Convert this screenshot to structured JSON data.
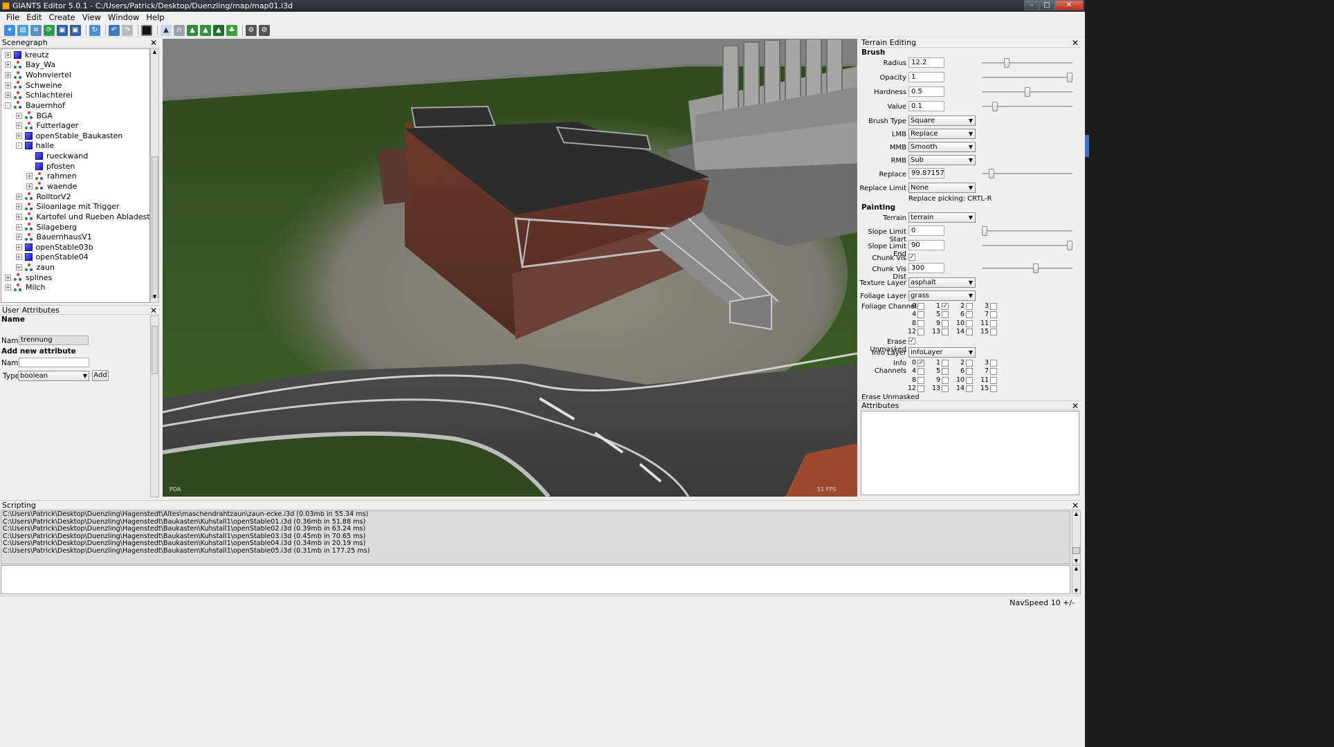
{
  "window": {
    "title": "GIANTS Editor 5.0.1 - C:/Users/Patrick/Desktop/Duenzling/map/map01.i3d"
  },
  "menu": [
    "File",
    "Edit",
    "Create",
    "View",
    "Window",
    "Help"
  ],
  "toolbar": {
    "icons": [
      "new-icon",
      "open-icon",
      "import-icon",
      "reload-icon",
      "save-icon",
      "save-all-icon",
      "refresh-icon",
      "undo-icon",
      "redo-icon",
      "stop-icon",
      "select-icon",
      "transform-icon",
      "terrain-sculpt-icon",
      "terrain-paint-icon",
      "foliage-paint-icon",
      "foliage-icon",
      "settings-icon",
      "render-settings-icon"
    ]
  },
  "scenegraph": {
    "title": "Scenegraph",
    "items": [
      {
        "label": "kreutz",
        "level": 0,
        "icon": "cube",
        "expander": "+"
      },
      {
        "label": "Bay_Wa",
        "level": 0,
        "icon": "transform",
        "expander": "+"
      },
      {
        "label": "Wohnviertel",
        "level": 0,
        "icon": "transform",
        "expander": "+"
      },
      {
        "label": "Schweine",
        "level": 0,
        "icon": "transform",
        "expander": "+"
      },
      {
        "label": "Schlachterei",
        "level": 0,
        "icon": "transform",
        "expander": "+"
      },
      {
        "label": "Bauernhof",
        "level": 0,
        "icon": "transform",
        "expander": "-"
      },
      {
        "label": "BGA",
        "level": 1,
        "icon": "transform",
        "expander": "+"
      },
      {
        "label": "Futterlager",
        "level": 1,
        "icon": "transform",
        "expander": "+"
      },
      {
        "label": "openStable_Baukasten",
        "level": 1,
        "icon": "cube",
        "expander": "+"
      },
      {
        "label": "halle",
        "level": 1,
        "icon": "cube",
        "expander": "-"
      },
      {
        "label": "rueckwand",
        "level": 2,
        "icon": "cube",
        "expander": ""
      },
      {
        "label": "pfosten",
        "level": 2,
        "icon": "cube",
        "expander": ""
      },
      {
        "label": "rahmen",
        "level": 2,
        "icon": "transform",
        "expander": "+"
      },
      {
        "label": "waende",
        "level": 2,
        "icon": "transform",
        "expander": "+"
      },
      {
        "label": "RolltorV2",
        "level": 1,
        "icon": "transform",
        "expander": "+"
      },
      {
        "label": "Siloanlage mit Trigger",
        "level": 1,
        "icon": "transform",
        "expander": "+"
      },
      {
        "label": "Kartofel und Rueben Abladestation",
        "level": 1,
        "icon": "transform",
        "expander": "+"
      },
      {
        "label": "Silageberg",
        "level": 1,
        "icon": "transform",
        "expander": "+"
      },
      {
        "label": "BauernhausV1",
        "level": 1,
        "icon": "transform",
        "expander": "+"
      },
      {
        "label": "openStable03b",
        "level": 1,
        "icon": "cube",
        "expander": "+"
      },
      {
        "label": "openStable04",
        "level": 1,
        "icon": "cube",
        "expander": "+"
      },
      {
        "label": "zaun",
        "level": 1,
        "icon": "transform",
        "expander": "+"
      },
      {
        "label": "splines",
        "level": 0,
        "icon": "transform",
        "expander": "+"
      },
      {
        "label": "Milch",
        "level": 0,
        "icon": "transform",
        "expander": "+"
      }
    ]
  },
  "user_attributes": {
    "title": "User Attributes",
    "name_header": "Name",
    "name_label": "Name",
    "name_value": "trennung",
    "add_new": "Add new attribute",
    "new_name_label": "Name",
    "new_name_value": "",
    "type_label": "Type",
    "type_value": "boolean",
    "add_button": "Add"
  },
  "viewport": {
    "overlay_left": "PDA",
    "overlay_right": "51 FPS"
  },
  "terrain_editing": {
    "title": "Terrain Editing",
    "brush_header": "Brush",
    "radius_label": "Radius",
    "radius": "12.2",
    "radius_slider": 0.26,
    "opacity_label": "Opacity",
    "opacity": "1",
    "opacity_slider": 1.0,
    "hardness_label": "Hardness",
    "hardness": "0.5",
    "hardness_slider": 0.5,
    "value_label": "Value",
    "value": "0.1",
    "value_slider": 0.12,
    "brush_type_label": "Brush Type",
    "brush_type": "Square",
    "lmb_label": "LMB",
    "lmb": "Replace",
    "mmb_label": "MMB",
    "mmb": "Smooth",
    "rmb_label": "RMB",
    "rmb": "Sub",
    "replace_label": "Replace",
    "replace": "99.87157",
    "replace_slider": 0.08,
    "replace_limit_label": "Replace Limit",
    "replace_limit": "None",
    "replace_picking": "Replace picking: CRTL-R",
    "painting_header": "Painting",
    "terrain_label": "Terrain",
    "terrain": "terrain",
    "slope_start_label": "Slope Limit Start",
    "slope_start": "0",
    "slope_start_slider": 0.0,
    "slope_end_label": "Slope Limit End",
    "slope_end": "90",
    "slope_end_slider": 1.0,
    "chunk_vis_label": "Chunk Vis",
    "chunk_vis": true,
    "chunk_vis_dist_label": "Chunk Vis Dist",
    "chunk_vis_dist": "300",
    "chunk_vis_dist_slider": 0.6,
    "texture_layer_label": "Texture Layer",
    "texture_layer": "asphalt",
    "foliage_layer_label": "Foliage Layer",
    "foliage_layer": "grass",
    "foliage_channels_label": "Foliage Channels",
    "foliage_channels_checked": [
      1
    ],
    "erase_unmasked_label": "Erase Unmasked",
    "erase_unmasked": true,
    "info_layer_label": "Info Layer",
    "info_layer": "infoLayer",
    "info_channels_label": "Info Channels",
    "info_channels_checked": [
      0
    ],
    "channel_numbers": [
      "0",
      "1",
      "2",
      "3",
      "4",
      "5",
      "6",
      "7",
      "8",
      "9",
      "10",
      "11",
      "12",
      "13",
      "14",
      "15"
    ]
  },
  "attributes": {
    "title": "Attributes"
  },
  "scripting": {
    "title": "Scripting",
    "log": [
      "C:\\Users\\Patrick\\Desktop\\Duenzling\\Hagenstedt\\Altes\\maschendrahtzaun\\zaun-ecke.i3d (0.03mb in 55.34 ms)",
      "C:\\Users\\Patrick\\Desktop\\Duenzling\\Hagenstedt\\Baukasten\\Kuhstall1\\openStable01.i3d (0.36mb in 51.88 ms)",
      "C:\\Users\\Patrick\\Desktop\\Duenzling\\Hagenstedt\\Baukasten\\Kuhstall1\\openStable02.i3d (0.39mb in 63.24 ms)",
      "C:\\Users\\Patrick\\Desktop\\Duenzling\\Hagenstedt\\Baukasten\\Kuhstall1\\openStable03.i3d (0.45mb in 70.65 ms)",
      "C:\\Users\\Patrick\\Desktop\\Duenzling\\Hagenstedt\\Baukasten\\Kuhstall1\\openStable04.i3d (0.34mb in 20.19 ms)",
      "C:\\Users\\Patrick\\Desktop\\Duenzling\\Hagenstedt\\Baukasten\\Kuhstall1\\openStable05.i3d (0.31mb in 177.25 ms)"
    ]
  },
  "status": {
    "navspeed": "NavSpeed 10 +/-"
  }
}
